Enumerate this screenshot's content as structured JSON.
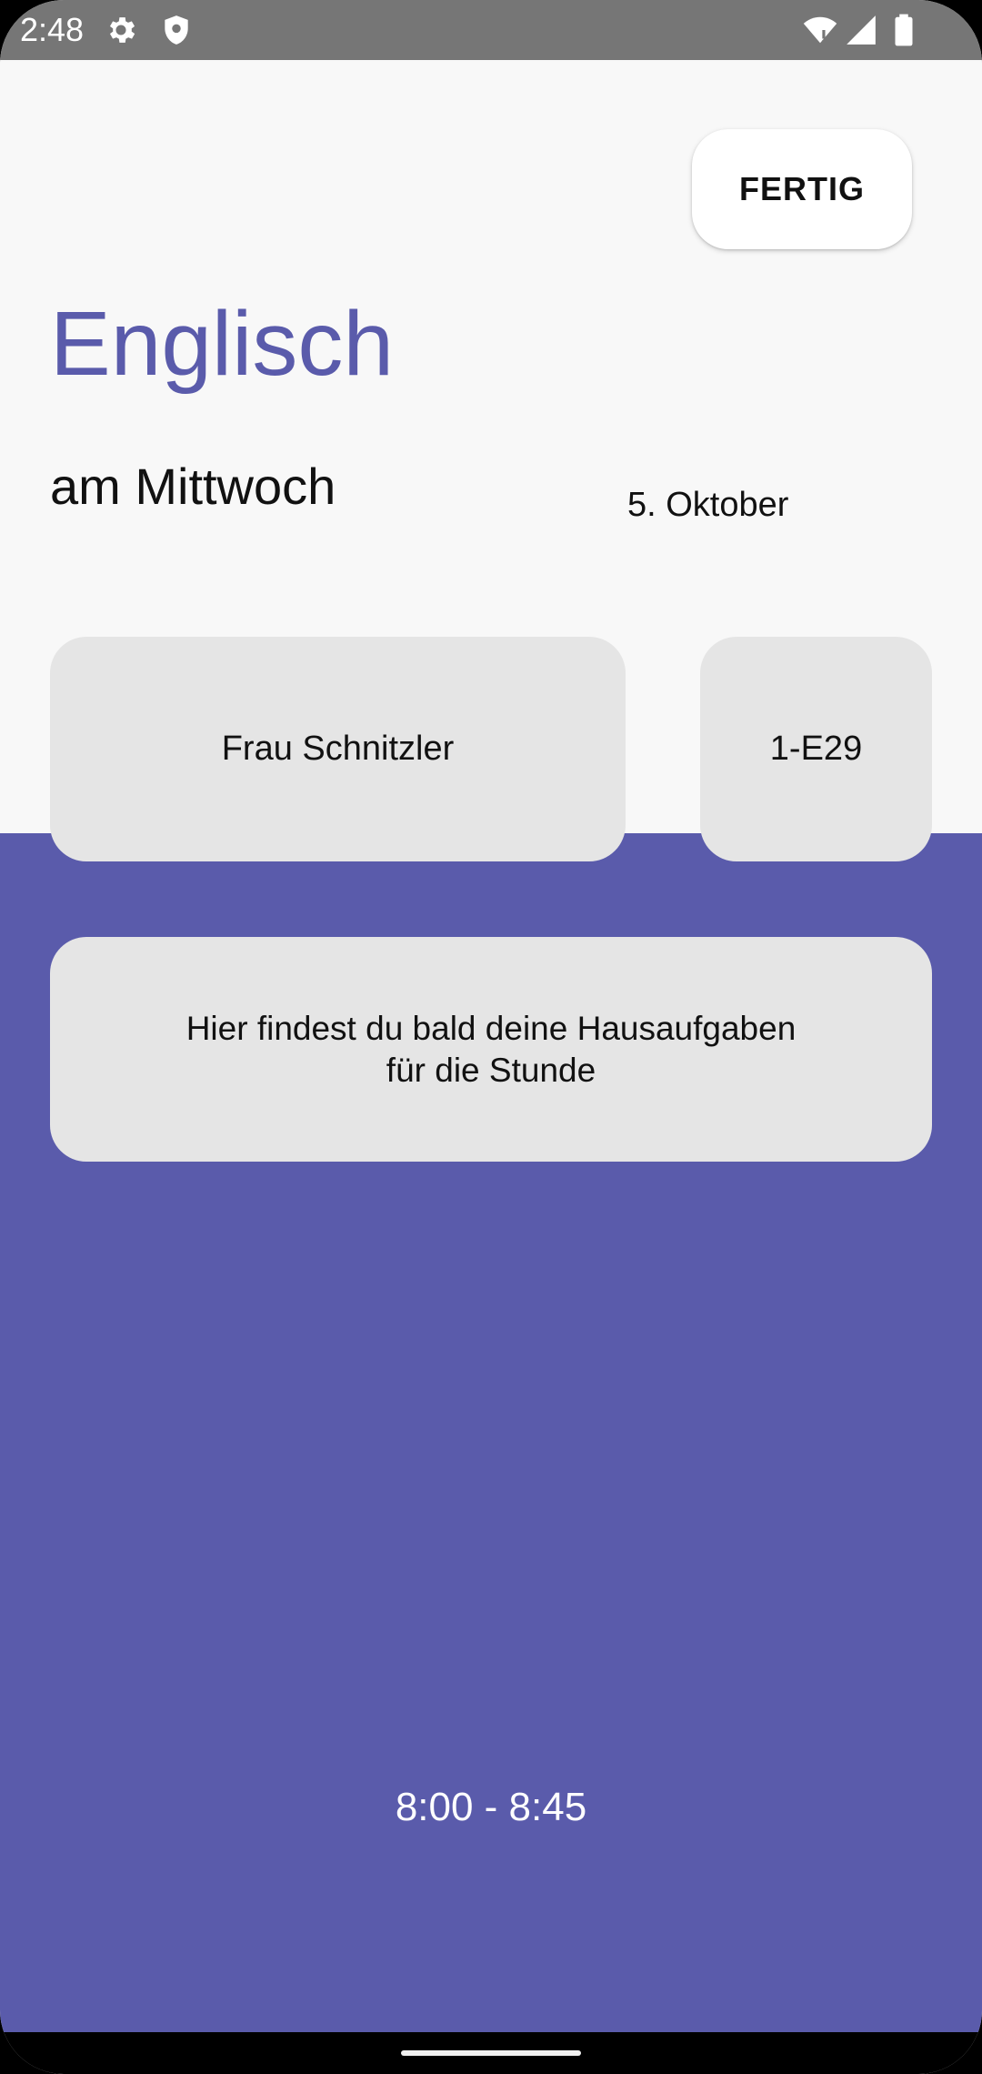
{
  "status_bar": {
    "time": "2:48",
    "icons": [
      "gear-icon",
      "shield-icon",
      "wifi-icon",
      "signal-icon",
      "battery-icon"
    ]
  },
  "toolbar": {
    "done_label": "FERTIG"
  },
  "lesson": {
    "subject": "Englisch",
    "weekday": "am Mittwoch",
    "date": "5. Oktober",
    "teacher": "Frau Schnitzler",
    "room": "1-E29",
    "homework_text": "Hier findest du bald deine Hausaufgaben\nfür die Stunde",
    "time_range": "8:00 - 8:45"
  },
  "colors": {
    "accent": "#5a5bab",
    "card_background": "#e5e5e5",
    "page_background": "#f8f8f8",
    "status_bar": "#767676"
  }
}
